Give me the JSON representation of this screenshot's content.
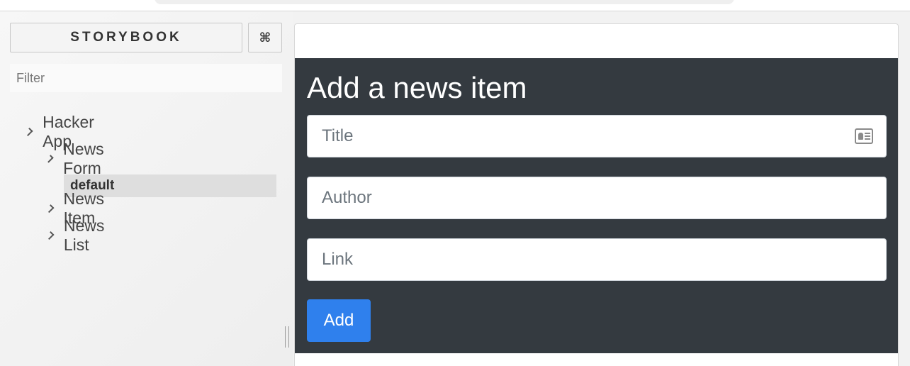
{
  "sidebar": {
    "brand_label": "STORYBOOK",
    "shortcuts_label": "⌘",
    "filter_placeholder": "Filter",
    "tree": {
      "root": "Hacker App",
      "news_form": "News Form",
      "news_form_default": "default",
      "news_item": "News Item",
      "news_list": "News List"
    }
  },
  "preview": {
    "form": {
      "title": "Add a news item",
      "title_placeholder": "Title",
      "author_placeholder": "Author",
      "link_placeholder": "Link",
      "submit_label": "Add"
    }
  },
  "icons": {
    "chevron": "chevron-right-icon",
    "contact_card": "contact-card-icon"
  },
  "colors": {
    "form_background": "#343a40",
    "button_primary": "#2f80ed",
    "sidebar_selected": "#dedede"
  }
}
